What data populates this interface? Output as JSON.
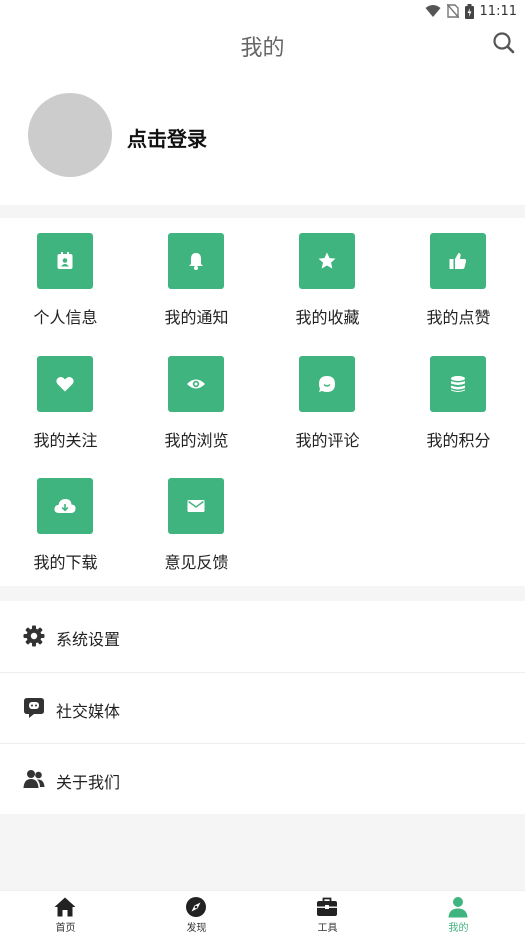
{
  "status_bar": {
    "time": "11:11"
  },
  "header": {
    "title": "我的"
  },
  "profile": {
    "login_label": "点击登录"
  },
  "grid": [
    {
      "label": "个人信息",
      "icon": "id-card-icon"
    },
    {
      "label": "我的通知",
      "icon": "bell-icon"
    },
    {
      "label": "我的收藏",
      "icon": "star-icon"
    },
    {
      "label": "我的点赞",
      "icon": "thumbs-up-icon"
    },
    {
      "label": "我的关注",
      "icon": "heart-icon"
    },
    {
      "label": "我的浏览",
      "icon": "eye-icon"
    },
    {
      "label": "我的评论",
      "icon": "comment-icon"
    },
    {
      "label": "我的积分",
      "icon": "coins-icon"
    },
    {
      "label": "我的下载",
      "icon": "cloud-download-icon"
    },
    {
      "label": "意见反馈",
      "icon": "envelope-icon"
    }
  ],
  "menu": [
    {
      "label": "系统设置",
      "icon": "gear-icon"
    },
    {
      "label": "社交媒体",
      "icon": "social-chat-icon"
    },
    {
      "label": "关于我们",
      "icon": "users-icon"
    }
  ],
  "tabbar": [
    {
      "label": "首页",
      "icon": "home-icon"
    },
    {
      "label": "发现",
      "icon": "compass-icon"
    },
    {
      "label": "工具",
      "icon": "toolbox-icon"
    },
    {
      "label": "我的",
      "icon": "person-icon"
    }
  ],
  "colors": {
    "accent": "#40b47e",
    "avatar": "#cccccc",
    "background": "#f5f5f5"
  }
}
